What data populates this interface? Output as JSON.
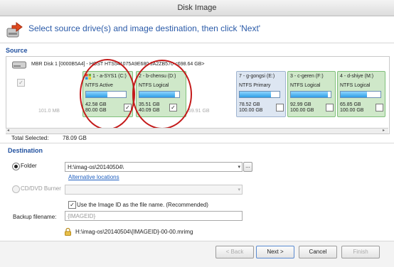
{
  "window": {
    "title": "Disk Image"
  },
  "header": {
    "text": "Select source drive(s) and image destination, then click 'Next'"
  },
  "source": {
    "label": "Source",
    "disk_label": "MBR Disk 1 [0000B5A4] - HGST HTS541075A9E680 JA2ZB570  <698.64 GB>",
    "unallocated_left": "101.0 MB",
    "unallocated_mid": "59.91 GB",
    "partitions": [
      {
        "name": "1 - a-SYS1 (C:)",
        "type": "NTFS Active",
        "used": "42.58 GB",
        "total": "80.00 GB",
        "fill": 0.53,
        "checked": true,
        "color": "#cfe8c9"
      },
      {
        "name": "2 - b-chensu (D:)",
        "type": "NTFS Logical",
        "used": "35.51 GB",
        "total": "40.09 GB",
        "fill": 0.89,
        "checked": true,
        "color": "#cfe8c9"
      },
      {
        "name": "7 - g-gongsi (E:)",
        "type": "NTFS Primary",
        "used": "78.52 GB",
        "total": "100.00 GB",
        "fill": 0.79,
        "checked": false,
        "color": "#dde6f2"
      },
      {
        "name": "3 - c-geren (F:)",
        "type": "NTFS Logical",
        "used": "92.99 GB",
        "total": "100.00 GB",
        "fill": 0.93,
        "checked": false,
        "color": "#cfe8c9"
      },
      {
        "name": "4 - d-shiye (M:)",
        "type": "NTFS Logical",
        "used": "65.85 GB",
        "total": "100.00 GB",
        "fill": 0.66,
        "checked": false,
        "color": "#cfe8c9"
      }
    ],
    "total_selected_label": "Total Selected:",
    "total_selected_value": "78.09 GB"
  },
  "destination": {
    "label": "Destination",
    "folder_label": "Folder",
    "folder_value": "H:\\imag-os\\20140504\\",
    "browse_label": "...",
    "alt_link": "Alternative locations",
    "cd_label": "CD/DVD Burner",
    "use_id_label": "Use the Image ID as the file name.  (Recommended)",
    "backup_filename_label": "Backup filename:",
    "backup_filename_placeholder": "{IMAGEID}",
    "path_preview": "H:\\imag-os\\20140504\\{IMAGEID}-00-00.mrimg"
  },
  "footer": {
    "back": "< Back",
    "next": "Next >",
    "cancel": "Cancel",
    "finish": "Finish"
  },
  "colors": {
    "accent": "#2a5aa8",
    "annotation": "#c41a1a"
  }
}
